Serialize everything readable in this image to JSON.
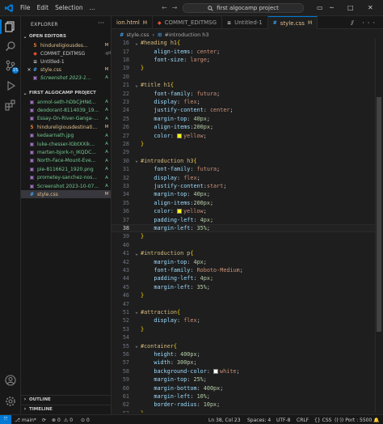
{
  "titlebar": {
    "menu": [
      "File",
      "Edit",
      "Selection",
      "..."
    ],
    "search_text": "first algocamp project"
  },
  "explorer": {
    "title": "EXPLORER",
    "open_editors_title": "OPEN EDITORS",
    "open_editors": [
      {
        "name": "hindureligiousdes...",
        "status": "M",
        "sub": ""
      },
      {
        "name": "COMMIT_EDITMSG",
        "status": "",
        "sub": ".git"
      },
      {
        "name": "Untitled-1",
        "status": "",
        "sub": ""
      },
      {
        "name": "style.css",
        "status": "M",
        "sub": ""
      },
      {
        "name": "Screenshot 2023-1...",
        "status": "A",
        "sub": ""
      }
    ],
    "project_title": "FIRST ALGOCAMP PROJECT",
    "files": [
      {
        "name": "anmol-seth-hDbCjHNd...",
        "status": "A"
      },
      {
        "name": "deodorant-8114039_19...",
        "status": "A"
      },
      {
        "name": "Essay-On-River-Ganga-...",
        "status": "A"
      },
      {
        "name": "hindureligiousdestinati...",
        "status": "M"
      },
      {
        "name": "kedaarnath.jpg",
        "status": "A"
      },
      {
        "name": "luke-chesser-lGbtXXik...",
        "status": "A"
      },
      {
        "name": "marten-bjork-n_IKQDC...",
        "status": "A"
      },
      {
        "name": "North-Face-Mount-Eve...",
        "status": "A"
      },
      {
        "name": "pie-8116621_1920.png",
        "status": "A"
      },
      {
        "name": "prometey-sanchez-nos...",
        "status": "A"
      },
      {
        "name": "Screenshot 2023-10-07...",
        "status": "A"
      },
      {
        "name": "style.css",
        "status": "M"
      }
    ],
    "outline_title": "OUTLINE",
    "timeline_title": "TIMELINE"
  },
  "tabs": [
    {
      "label": "ion.html",
      "status": "M",
      "icon": "html"
    },
    {
      "label": "COMMIT_EDITMSG",
      "status": "",
      "icon": "git"
    },
    {
      "label": "Untitled-1",
      "status": "",
      "icon": "txt"
    },
    {
      "label": "style.css",
      "status": "M",
      "icon": "css"
    }
  ],
  "breadcrumb": {
    "file": "style.css",
    "symbol": "#introduction h3"
  },
  "code_lines": [
    {
      "n": "16",
      "text": "#heading h1{"
    },
    {
      "n": "17",
      "text": "    align-items: center;"
    },
    {
      "n": "18",
      "text": "    font-size: large;"
    },
    {
      "n": "19",
      "text": "}"
    },
    {
      "n": "20",
      "text": ""
    },
    {
      "n": "21",
      "text": "#title h1{"
    },
    {
      "n": "22",
      "text": "    font-family: futura;"
    },
    {
      "n": "23",
      "text": "    display: flex;"
    },
    {
      "n": "24",
      "text": "    justify-content: center;"
    },
    {
      "n": "25",
      "text": "    margin-top: 40px;"
    },
    {
      "n": "26",
      "text": "    align-items:200px;"
    },
    {
      "n": "27",
      "text": "    color: yellow;"
    },
    {
      "n": "28",
      "text": "}"
    },
    {
      "n": "29",
      "text": ""
    },
    {
      "n": "30",
      "text": "#introduction h3{"
    },
    {
      "n": "31",
      "text": "    font-family: futura;"
    },
    {
      "n": "32",
      "text": "    display: flex;"
    },
    {
      "n": "33",
      "text": "    justify-content:start;"
    },
    {
      "n": "34",
      "text": "    margin-top: 40px;"
    },
    {
      "n": "35",
      "text": "    align-items:200px;"
    },
    {
      "n": "36",
      "text": "    color: yellow;"
    },
    {
      "n": "37",
      "text": "    padding-left: 4px;"
    },
    {
      "n": "38",
      "text": "    margin-left: 35%;"
    },
    {
      "n": "39",
      "text": "}"
    },
    {
      "n": "40",
      "text": ""
    },
    {
      "n": "41",
      "text": "#introduction p{"
    },
    {
      "n": "42",
      "text": "    margin-top: 4px;"
    },
    {
      "n": "43",
      "text": "    font-family: Roboto-Medium;"
    },
    {
      "n": "44",
      "text": "    padding-left: 4px;"
    },
    {
      "n": "45",
      "text": "    margin-left: 35%;"
    },
    {
      "n": "46",
      "text": "}"
    },
    {
      "n": "47",
      "text": ""
    },
    {
      "n": "51",
      "text": "#attraction{"
    },
    {
      "n": "52",
      "text": "    display: flex;"
    },
    {
      "n": "53",
      "text": "}"
    },
    {
      "n": "54",
      "text": ""
    },
    {
      "n": "55",
      "text": "#container{"
    },
    {
      "n": "56",
      "text": "    height: 400px;"
    },
    {
      "n": "57",
      "text": "    width: 300px;"
    },
    {
      "n": "58",
      "text": "    background-color: white;"
    },
    {
      "n": "59",
      "text": "    margin-top: 25%;"
    },
    {
      "n": "60",
      "text": "    margin-bottom: 400px;"
    },
    {
      "n": "61",
      "text": "    margin-left: 10%;"
    },
    {
      "n": "62",
      "text": "    border-radius: 10px;"
    },
    {
      "n": "63",
      "text": "}"
    }
  ],
  "current_line": "38",
  "statusbar": {
    "branch": "main*",
    "errors": "0",
    "warnings": "0",
    "ports": "0",
    "position": "Ln 38, Col 23",
    "spaces": "Spaces: 4",
    "encoding": "UTF-8",
    "eol": "CRLF",
    "language": "CSS",
    "port": "Port : 5500"
  },
  "colors": {
    "accent": "#0078d4",
    "modified": "#e2c08d",
    "added": "#73c991",
    "yellow_swatch": "#ffff00",
    "white_swatch": "#ffffff"
  }
}
